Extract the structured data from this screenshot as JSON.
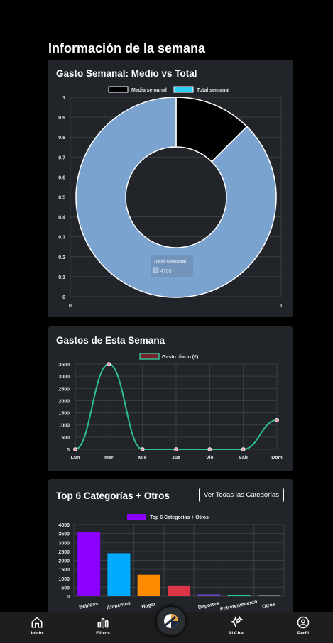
{
  "page_title": "Información de la semana",
  "cards": {
    "donut_title": "Gasto Semanal: Medio vs Total",
    "line_title": "Gastos de Esta Semana",
    "bar_title": "Top 6 Categorías + Otros",
    "bar_button": "Ver Todas las Categorías"
  },
  "chart_data": [
    {
      "type": "pie",
      "variant": "doughnut",
      "labels": [
        "Media semanal",
        "Total semanal"
      ],
      "values": [
        672,
        4705
      ],
      "colors": [
        "#000000",
        "#7ba3cf"
      ],
      "legend_colors": [
        "#000000",
        "#2ecbf5"
      ],
      "legend": "top",
      "axes_ticks_y": [
        "0",
        "0.1",
        "0.2",
        "0.3",
        "0.4",
        "0.5",
        "0.6",
        "0.7",
        "0.8",
        "0.9",
        "1"
      ],
      "axes_ticks_x": [
        "0",
        "1"
      ],
      "tooltip": {
        "title": "Total semanal",
        "value": "4705"
      }
    },
    {
      "type": "line",
      "series": [
        {
          "name": "Gasto diario (€)",
          "values": [
            0,
            3500,
            0,
            0,
            0,
            0,
            1200
          ],
          "color": "#2fbf8f"
        }
      ],
      "categories": [
        "Lun",
        "Mar",
        "Mié",
        "Jue",
        "Vie",
        "Sáb",
        "Dom"
      ],
      "ylim": [
        0,
        3500
      ],
      "yticks": [
        0,
        500,
        1000,
        1500,
        2000,
        2500,
        3000,
        3500
      ],
      "legend": "top",
      "grid": true
    },
    {
      "type": "bar",
      "series": [
        {
          "name": "Top 6 Categorías + Otros",
          "values": [
            3600,
            2400,
            1200,
            600,
            100,
            60,
            60
          ]
        }
      ],
      "categories": [
        "Bebidas",
        "Alimentos",
        "Hogar",
        "",
        "Deportes",
        "Entretenimiento",
        "Otros"
      ],
      "colors": [
        "#8b00ff",
        "#00aaff",
        "#ff8c00",
        "#dc3545",
        "#6f42c1",
        "#20c997",
        "#6c757d"
      ],
      "ylim": [
        0,
        4000
      ],
      "yticks": [
        0,
        500,
        1000,
        1500,
        2000,
        2500,
        3000,
        3500,
        4000
      ],
      "legend": "top",
      "legend_color": "#8b00ff",
      "grid": true
    }
  ],
  "nav": {
    "items": [
      {
        "label": "Inicio",
        "icon": "home-icon"
      },
      {
        "label": "Filtros",
        "icon": "bar-chart-icon"
      },
      {
        "label": "AI Chat",
        "icon": "sparkles-icon"
      },
      {
        "label": "Perfil",
        "icon": "user-circle-icon"
      }
    ],
    "center_icon": "app-logo-icon"
  }
}
